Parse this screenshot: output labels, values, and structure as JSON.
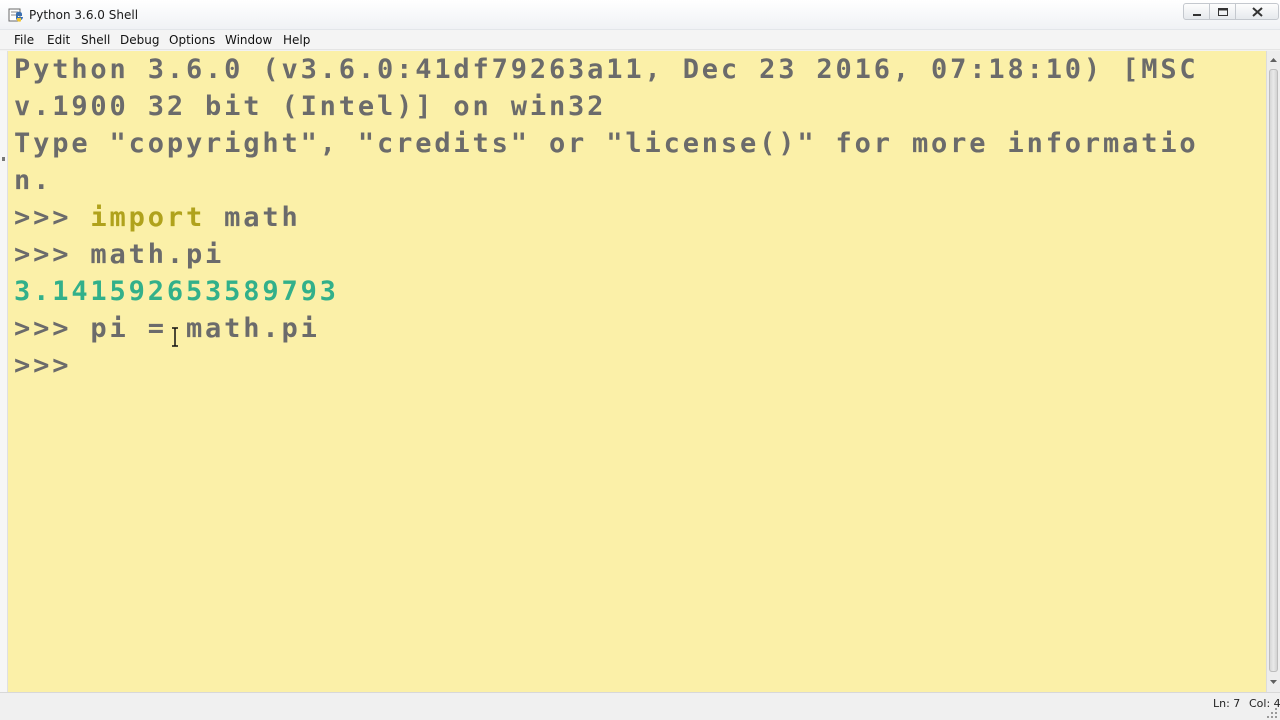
{
  "window": {
    "title": "Python 3.6.0 Shell",
    "icon": "python-idle-icon"
  },
  "menu": {
    "items": [
      {
        "label": "File"
      },
      {
        "label": "Edit"
      },
      {
        "label": "Shell"
      },
      {
        "label": "Debug"
      },
      {
        "label": "Options"
      },
      {
        "label": "Window"
      },
      {
        "label": "Help"
      }
    ]
  },
  "shell": {
    "banner_line1": "Python 3.6.0 (v3.6.0:41df79263a11, Dec 23 2016, 07:18:10) [MSC",
    "banner_line2": "v.1900 32 bit (Intel)] on win32",
    "banner_line3": "Type \"copyright\", \"credits\" or \"license()\" for more informatio",
    "banner_line4": "n.",
    "prompt": ">>> ",
    "line1_keyword": "import",
    "line1_rest": " math",
    "line2_code": "math.pi",
    "line3_output": "3.141592653589793",
    "line4_code": "pi = math.pi"
  },
  "colors": {
    "background": "#fbf0a8",
    "text": "#6b6b6b",
    "keyword": "#b0a21c",
    "output": "#32b08a"
  },
  "status": {
    "line": "Ln: 7",
    "col": "Col: 4"
  }
}
